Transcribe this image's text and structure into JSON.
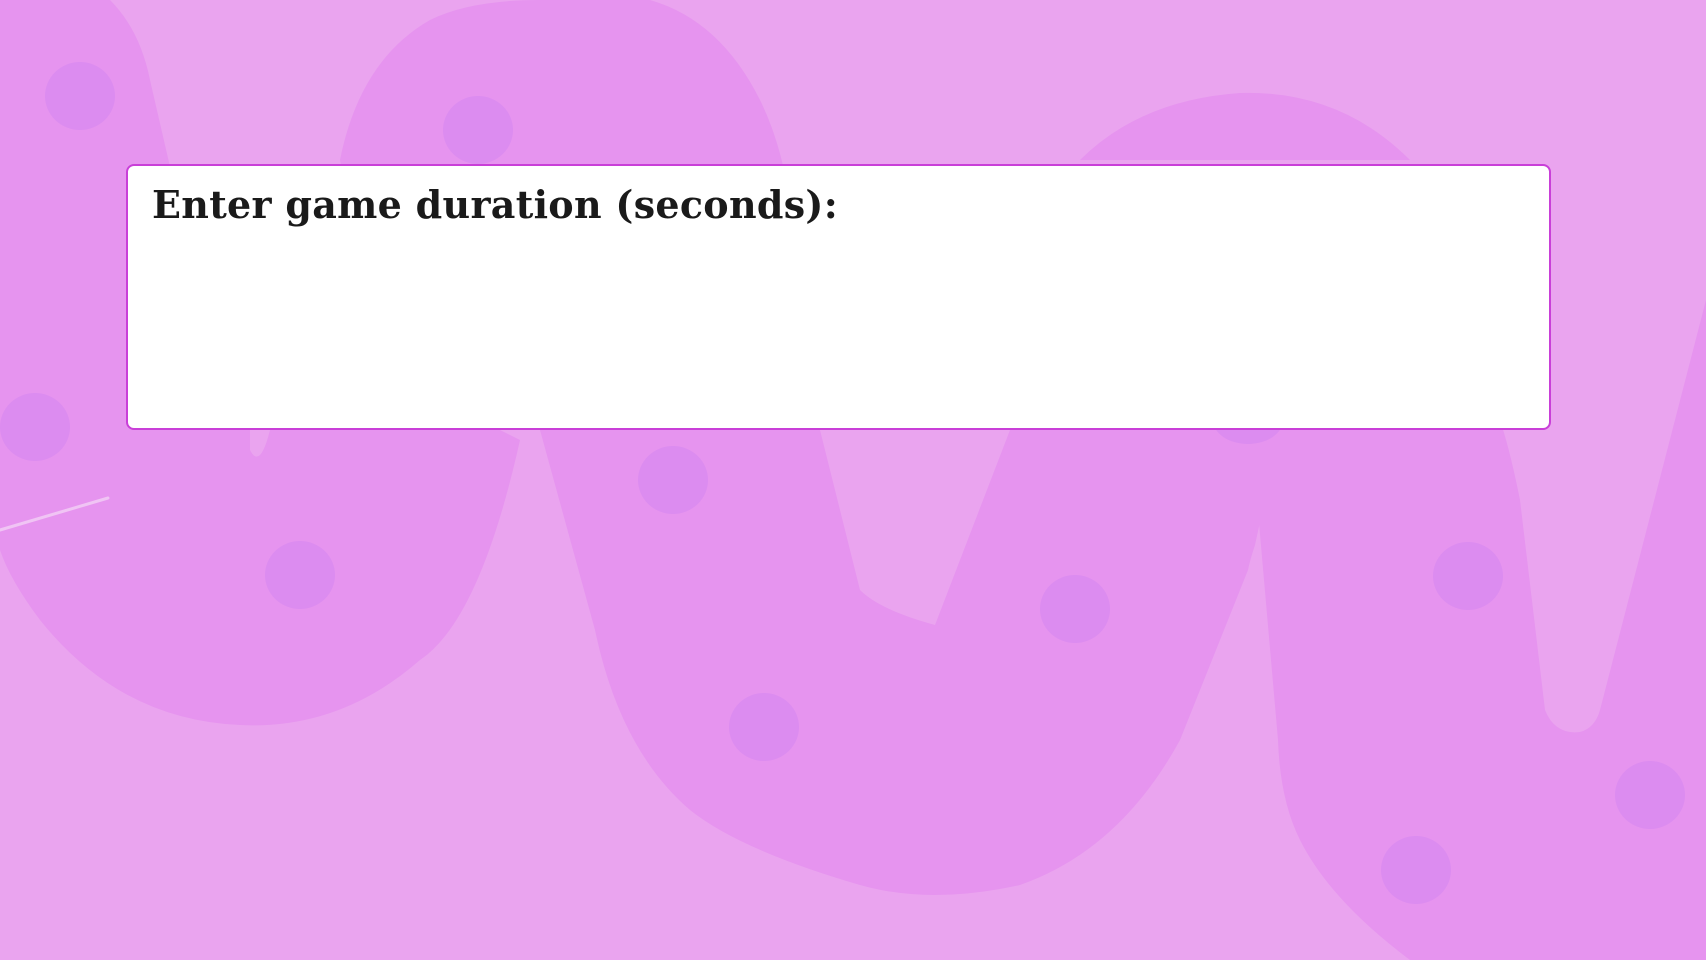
{
  "prompt": {
    "label": "Enter game duration (seconds):"
  },
  "theme": {
    "background_color": "#eaa4ef",
    "shape_color": "#e694ef",
    "dot_color": "#dc8cf0",
    "dialog_border_color": "#c93fd8"
  }
}
